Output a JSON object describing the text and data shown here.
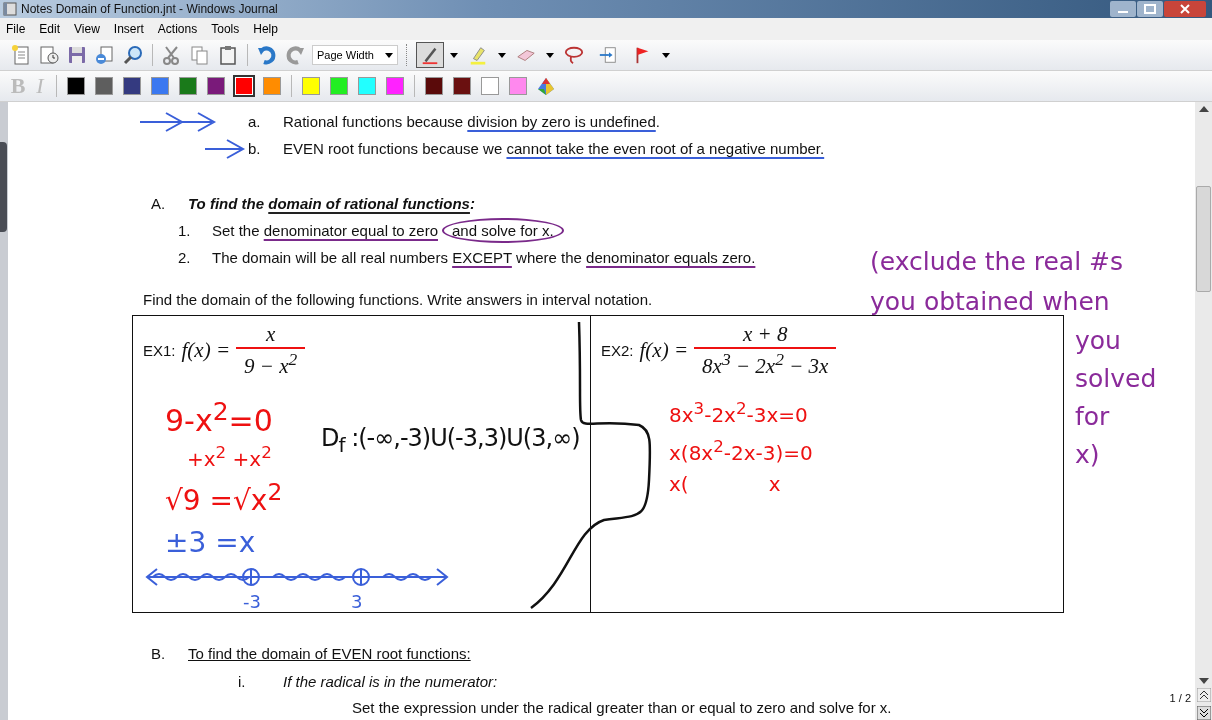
{
  "window": {
    "title": "Notes Domain of Function.jnt - Windows Journal"
  },
  "menu": [
    "File",
    "Edit",
    "View",
    "Insert",
    "Actions",
    "Tools",
    "Help"
  ],
  "toolbar": {
    "zoom": "Page Width",
    "tools": [
      {
        "kind": "pen",
        "selected": true,
        "dropdown": true
      },
      {
        "kind": "highlighter",
        "selected": false,
        "dropdown": true
      },
      {
        "kind": "eraser",
        "selected": false,
        "dropdown": true
      },
      {
        "kind": "lasso",
        "selected": false,
        "dropdown": false
      },
      {
        "kind": "space",
        "selected": false,
        "dropdown": false
      },
      {
        "kind": "flag",
        "selected": false,
        "dropdown": true
      }
    ]
  },
  "format_buttons": [
    {
      "label": "B",
      "disabled": true
    },
    {
      "label": "I",
      "disabled": true
    }
  ],
  "pen_colors": [
    {
      "color": "#000000",
      "selected": false
    },
    {
      "color": "#5e5e5e",
      "selected": false
    },
    {
      "color": "#343a80",
      "selected": false
    },
    {
      "color": "#3b78f0",
      "selected": false
    },
    {
      "color": "#1a7a1a",
      "selected": false
    },
    {
      "color": "#7a1a7a",
      "selected": false
    },
    {
      "color": "#ff0000",
      "selected": true
    },
    {
      "color": "#ff8c00",
      "selected": false
    },
    {
      "color": "#ffff00",
      "selected": false
    },
    {
      "color": "#22ee22",
      "selected": false
    },
    {
      "color": "#22ffff",
      "selected": false
    },
    {
      "color": "#ff22ff",
      "selected": false
    },
    {
      "color": "#5a0a0a",
      "selected": false
    },
    {
      "color": "#6a1010",
      "selected": false
    },
    {
      "color": "#ffffff",
      "selected": false
    },
    {
      "color": "#ff88ee",
      "selected": false
    }
  ],
  "reasons": [
    {
      "marker": "a.",
      "kind": "double_arrow",
      "parts": [
        {
          "text": "Rational functions because "
        },
        {
          "text": "division by zero is undefined",
          "underlined": true
        },
        {
          "text": "."
        }
      ]
    },
    {
      "marker": "b.",
      "kind": "single_arrow",
      "parts": [
        {
          "text": "EVEN root functions because we "
        },
        {
          "text": "cannot take the even root of a negative number.",
          "underlined": true
        }
      ]
    }
  ],
  "section_a": {
    "marker": "A.",
    "parts": [
      {
        "text": "To find the "
      },
      {
        "text": "domain of rational functions",
        "underlined": true
      },
      {
        "text": ":"
      }
    ],
    "steps": [
      {
        "marker": "1.",
        "parts": [
          {
            "text": "Set the "
          },
          {
            "text": "denominator equal to zero",
            "underlined": true
          },
          {
            "text": "and solve for x.",
            "circled": true
          }
        ]
      },
      {
        "marker": "2.",
        "parts": [
          {
            "text": "The domain will be all real numbers "
          },
          {
            "text": "EXCEPT",
            "underlined": true
          },
          {
            "text": " where the "
          },
          {
            "text": "denominator equals zero.",
            "underlined": true
          }
        ]
      }
    ]
  },
  "side_note": {
    "color": "#8a2a9a",
    "lines": [
      "(exclude the real #s",
      "you obtained when",
      "you",
      "solved",
      "for",
      "x)"
    ]
  },
  "instruction": "Find the domain of the following functions.  Write answers in interval notation.",
  "examples": [
    {
      "label": "EX1:",
      "function": "f(x) =",
      "numerator": "x",
      "denominator": "9 − x$^{2}$",
      "ink": [
        {
          "color": "#ee1111",
          "pieces": [
            "9-x$^{2}$=0"
          ]
        },
        {
          "color": "#ee1111",
          "pieces": [
            "+x$^{2}$ +x$^{2}$"
          ]
        },
        {
          "color": "#ee1111",
          "pieces": [
            "√9 =√x$^{2}$"
          ]
        },
        {
          "color": "#3a5fd9",
          "pieces": [
            "±3 =x"
          ]
        }
      ],
      "number_line": {
        "color": "#3a5fd9",
        "labels": [
          "-3",
          "3"
        ]
      },
      "answer": "D$_{f}$ :(-∞,-3)U(-3,3)U(3,∞)"
    },
    {
      "label": "EX2:",
      "function": "f(x) =",
      "numerator": "x + 8",
      "denominator": "8x$^{3}$ − 2x$^{2}$ − 3x",
      "ink": [
        {
          "color": "#ee1111",
          "pieces": [
            "8x$^{3}$-2x$^{2}$-3x=0"
          ]
        },
        {
          "color": "#ee1111",
          "pieces": [
            "x(8x$^{2}$-2x-3)=0"
          ]
        },
        {
          "color": "#ee1111",
          "pieces": [
            "x(",
            "x"
          ]
        }
      ]
    }
  ],
  "section_b": {
    "marker": "B.",
    "heading": "To find the domain of EVEN root functions:",
    "sub": {
      "marker": "i.",
      "heading": "If the radical is in the numerator:",
      "body": "Set the expression under the radical greater than or equal to zero and solve for x."
    }
  },
  "page_indicator": "1 / 2"
}
